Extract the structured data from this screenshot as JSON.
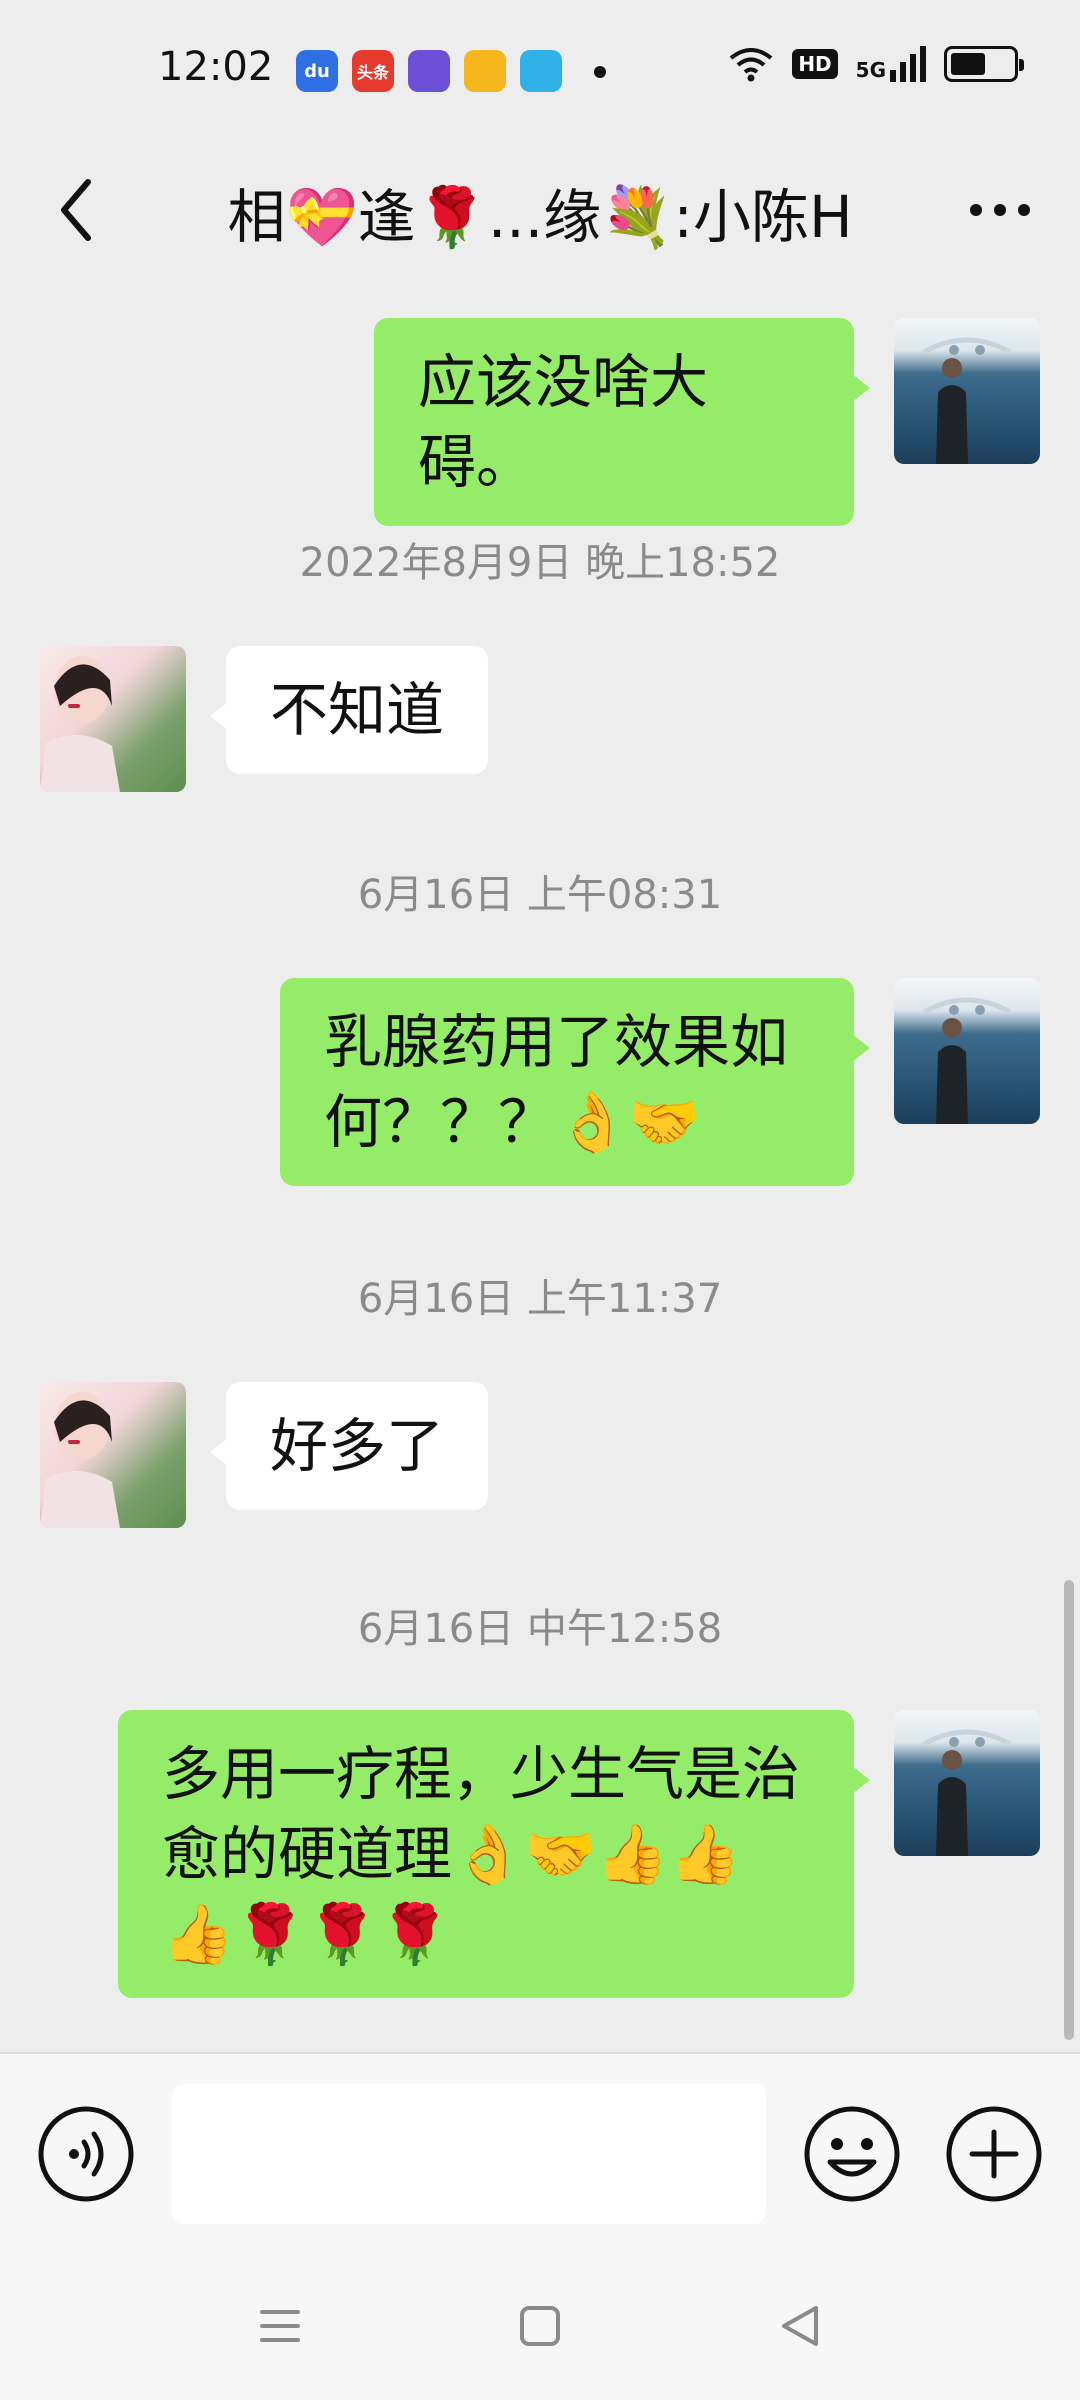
{
  "status": {
    "time": "12:02",
    "hd": "HD",
    "network": "5G",
    "battery_level": 0.55,
    "apps": [
      {
        "name": "baidu-app-icon",
        "label": "du",
        "color": "#2f6fe4"
      },
      {
        "name": "toutiao-app-icon",
        "label": "头条",
        "color": "#e63a2e"
      },
      {
        "name": "purple-app-icon",
        "label": "",
        "color": "#6b4fd6"
      },
      {
        "name": "weibo-app-icon",
        "label": "",
        "color": "#f5b51c"
      },
      {
        "name": "video-app-icon",
        "label": "",
        "color": "#2fb1e8"
      }
    ]
  },
  "header": {
    "title": "相💝逢🌹...缘💐:小陈H"
  },
  "messages": {
    "m1": "应该没啥大碍。",
    "t1": "2022年8月9日 晚上18:52",
    "m2": "不知道",
    "t2": "6月16日 上午08:31",
    "m3": "乳腺药用了效果如何？？？👌🤝",
    "t3": "6月16日 上午11:37",
    "m4": "好多了",
    "t4": "6月16日 中午12:58",
    "m5": "多用一疗程，少生气是治愈的硬道理👌🤝👍👍👍🌹🌹🌹"
  },
  "input": {
    "value": ""
  },
  "colors": {
    "my_bubble": "#95ec69",
    "their_bubble": "#ffffff",
    "background": "#ededed"
  }
}
